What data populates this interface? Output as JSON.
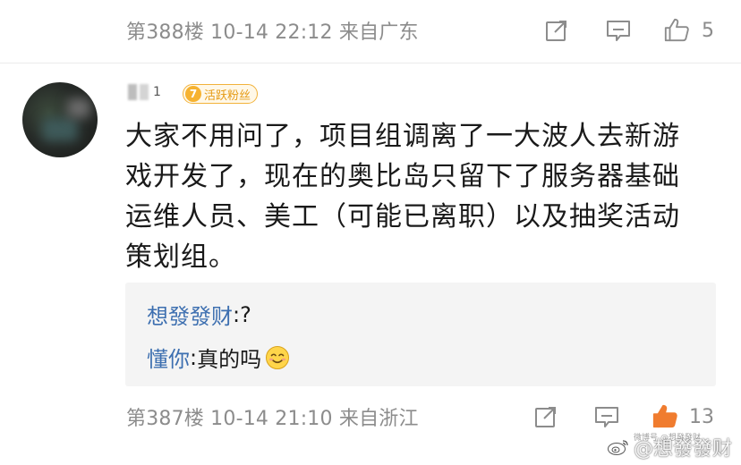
{
  "top_row": {
    "floor_info": "第388楼 10-14 22:12 来自广东",
    "like_count": "5",
    "icons": [
      "share-icon",
      "comment-icon",
      "like-icon"
    ]
  },
  "comment": {
    "username_suffix": "1",
    "badge_level": "7",
    "badge_label": "活跃粉丝",
    "text": "大家不用问了，项目组调离了一大波人去新游戏开发了，现在的奥比岛只留下了服务器基础运维人员、美工（可能已离职）以及抽奖活动策划组。",
    "replies": [
      {
        "name": "想發發财",
        "sep": ": ",
        "text": "?"
      },
      {
        "name": "懂你",
        "sep": ": ",
        "text": "真的吗",
        "emoji": "smile-icon"
      }
    ]
  },
  "bottom_row": {
    "floor_info": "第387楼 10-14 21:10 来自浙江",
    "like_count": "13",
    "icons": [
      "share-icon",
      "comment-icon",
      "like-icon-active"
    ]
  },
  "watermark": {
    "text": "@想發發财",
    "small_text": "微博号 @想發發财"
  },
  "colors": {
    "meta_gray": "#8c8c8c",
    "reply_name_blue": "#3d6fb0",
    "badge_orange": "#f2b23a",
    "like_active_orange": "#f07c2f"
  }
}
